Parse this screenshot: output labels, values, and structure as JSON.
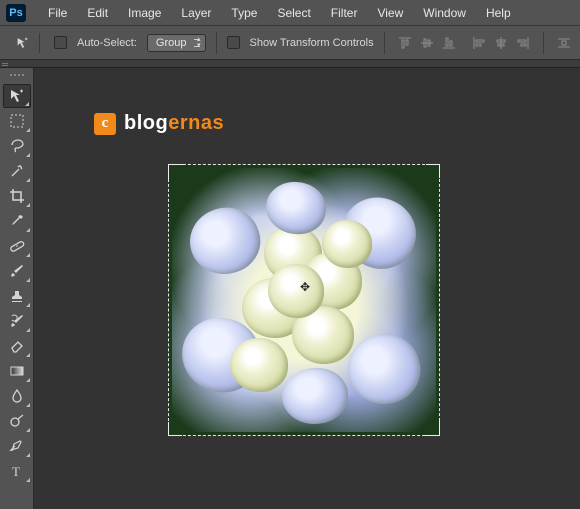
{
  "app": {
    "logo": "Ps"
  },
  "menu": [
    "File",
    "Edit",
    "Image",
    "Layer",
    "Type",
    "Select",
    "Filter",
    "View",
    "Window",
    "Help"
  ],
  "options": {
    "auto_select_label": "Auto-Select:",
    "group_label": "Group",
    "show_transform_label": "Show Transform Controls"
  },
  "tools": [
    {
      "name": "move",
      "active": true
    },
    {
      "name": "marquee"
    },
    {
      "name": "lasso"
    },
    {
      "name": "quick-select"
    },
    {
      "name": "crop"
    },
    {
      "name": "eyedropper"
    },
    {
      "name": "healing"
    },
    {
      "name": "brush"
    },
    {
      "name": "stamp"
    },
    {
      "name": "history-brush"
    },
    {
      "name": "eraser"
    },
    {
      "name": "gradient"
    },
    {
      "name": "blur"
    },
    {
      "name": "dodge"
    },
    {
      "name": "pen"
    },
    {
      "name": "type"
    }
  ],
  "watermark": {
    "badge": "c",
    "part1": "blog",
    "part2": "ernas"
  }
}
